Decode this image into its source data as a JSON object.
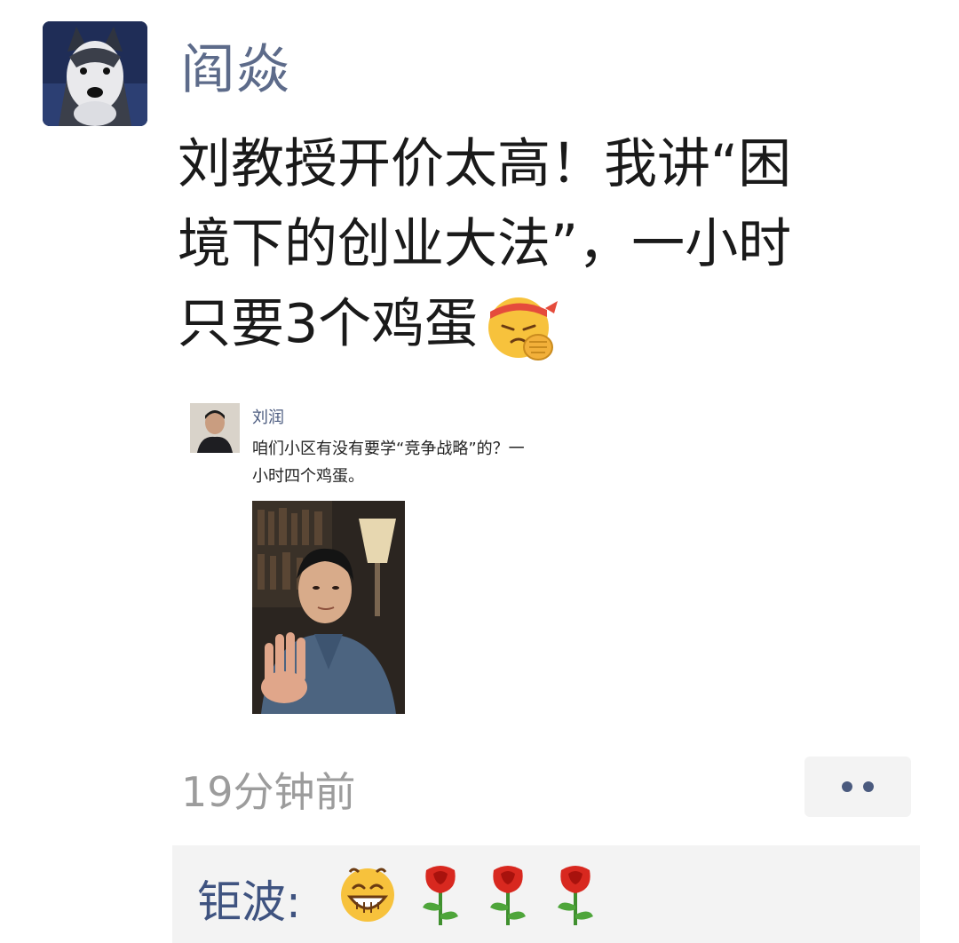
{
  "post": {
    "author": "阎焱",
    "text_lines": [
      "刘教授开价太高！我讲“困",
      "境下的创业大法”，一小时",
      "只要3个鸡蛋"
    ],
    "emoji": "facepalm-bandana-emoji"
  },
  "shared": {
    "author": "刘润",
    "text_lines": [
      "咱们小区有没有要学“竞争战略”的？一",
      "小时四个鸡蛋。"
    ]
  },
  "timestamp": "19分钟前",
  "comment": {
    "author": "钜波:",
    "emojis": [
      "grin-emoji",
      "rose-emoji",
      "rose-emoji",
      "rose-emoji"
    ]
  },
  "colors": {
    "name_blue": "#5d6b8a",
    "comment_blue": "#3f5380",
    "time_gray": "#9c9c9c",
    "comment_bg": "#f3f3f3"
  }
}
